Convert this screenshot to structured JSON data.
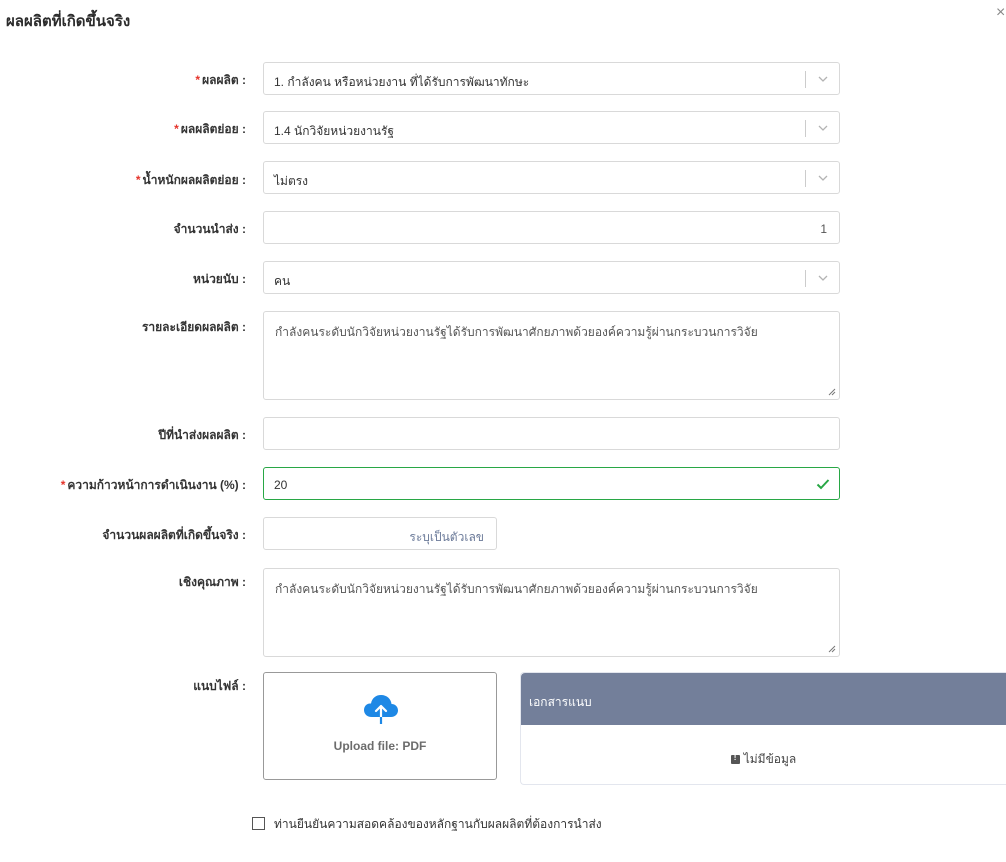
{
  "modal": {
    "title": "ผลผลิตที่เกิดขึ้นจริง",
    "close": "×"
  },
  "form": {
    "required_mark": "*",
    "output": {
      "label": "ผลผลิต :",
      "value": "1. กำลังคน หรือหน่วยงาน ที่ได้รับการพัฒนาทักษะ"
    },
    "sub_output": {
      "label": "ผลผลิตย่อย :",
      "value": "1.4 นักวิจัยหน่วยงานรัฐ"
    },
    "sub_weight": {
      "label": "น้ำหนักผลผลิตย่อย :",
      "value": "ไม่ตรง"
    },
    "delivery_count": {
      "label": "จำนวนนำส่ง :",
      "value": "1"
    },
    "unit": {
      "label": "หน่วยนับ :",
      "value": "คน"
    },
    "details": {
      "label": "รายละเอียดผลผลิต :",
      "value": "กำลังคนระดับนักวิจัยหน่วยงานรัฐได้รับการพัฒนาศักยภาพด้วยองค์ความรู้ผ่านกระบวนการวิจัย"
    },
    "delivery_year": {
      "label": "ปีที่นำส่งผลผลิต :",
      "value": ""
    },
    "progress": {
      "label": "ความก้าวหน้าการดำเนินงาน (%) :",
      "value": "20"
    },
    "actual_count": {
      "label": "จำนวนผลผลิตที่เกิดขึ้นจริง :",
      "placeholder": "ระบุเป็นตัวเลข"
    },
    "qualitative": {
      "label": "เชิงคุณภาพ :",
      "value": "กำลังคนระดับนักวิจัยหน่วยงานรัฐได้รับการพัฒนาศักยภาพด้วยองค์ความรู้ผ่านกระบวนการวิจัย"
    },
    "attach": {
      "label": "แนบไฟล์ :",
      "upload_text": "Upload file: PDF"
    }
  },
  "attachments": {
    "header": "เอกสารแนบ",
    "empty": "ไม่มีข้อมูล"
  },
  "confirm": {
    "label": "ท่านยืนยันความสอดคล้องของหลักฐานกับผลผลิตที่ต้องการนำส่ง"
  },
  "colors": {
    "required": "#e5332a",
    "success": "#28a745",
    "upload_icon": "#1e88e5",
    "attach_header": "#737f9a"
  },
  "icons": {
    "close": "close-icon",
    "dropdown": "chevron-down-icon",
    "valid": "checkmark-icon",
    "resize": "resize-handle-icon",
    "upload": "cloud-upload-icon",
    "empty": "info-icon"
  }
}
